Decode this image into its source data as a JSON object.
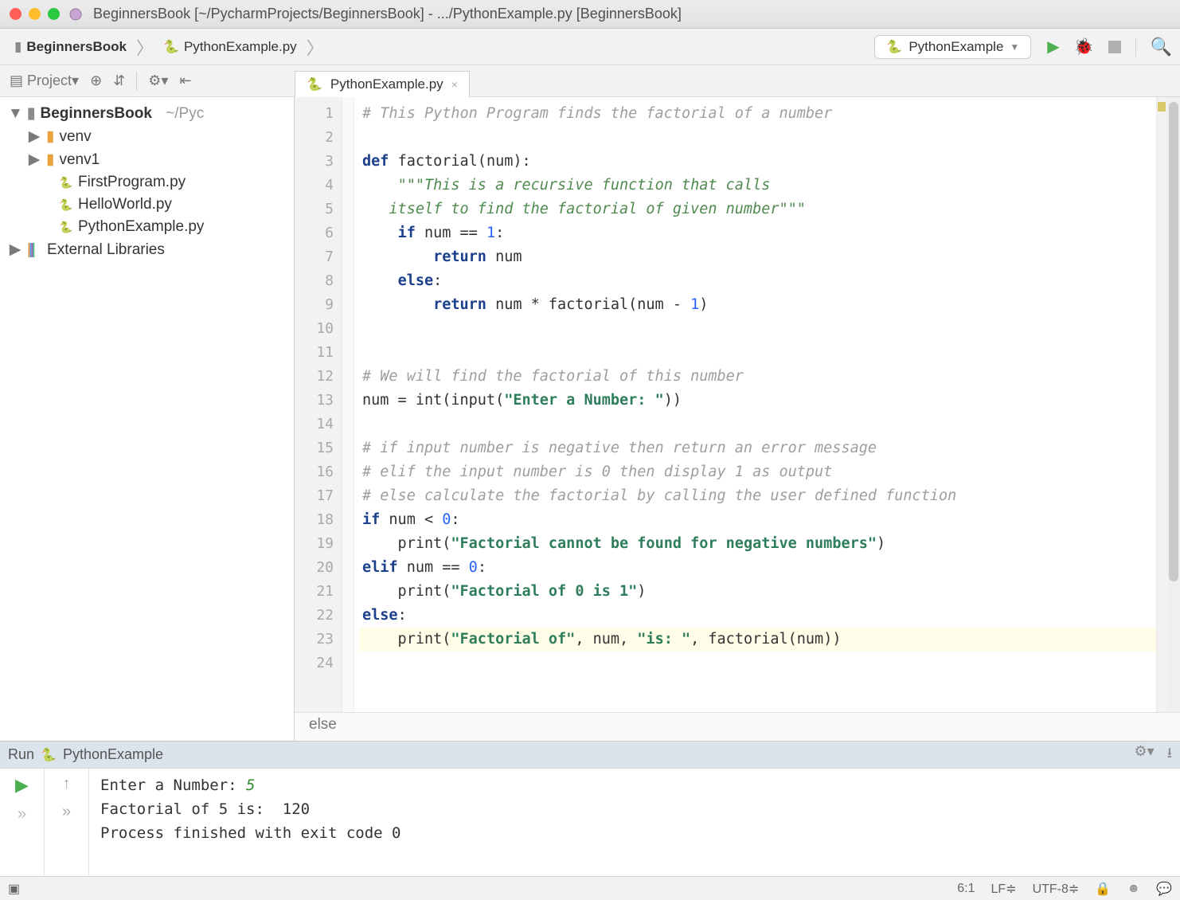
{
  "titlebar": {
    "title": "BeginnersBook [~/PycharmProjects/BeginnersBook] - .../PythonExample.py [BeginnersBook]"
  },
  "breadcrumbs": {
    "items": [
      "BeginnersBook",
      "PythonExample.py"
    ]
  },
  "run_config": {
    "label": "PythonExample"
  },
  "project_tool": {
    "label": "Project"
  },
  "tab": {
    "label": "PythonExample.py"
  },
  "tree": {
    "root": {
      "name": "BeginnersBook",
      "path": "~/PycharmProjects/BeginnersBook"
    },
    "folders": [
      "venv",
      "venv1"
    ],
    "files": [
      "FirstProgram.py",
      "HelloWorld.py",
      "PythonExample.py"
    ],
    "ext": "External Libraries"
  },
  "code": {
    "lines": [
      {
        "n": 1,
        "seg": [
          {
            "t": "# This Python Program finds the factorial of a number",
            "c": "c-comment"
          }
        ]
      },
      {
        "n": 2,
        "seg": []
      },
      {
        "n": 3,
        "seg": [
          {
            "t": "def ",
            "c": "c-kw"
          },
          {
            "t": "factorial(num):",
            "c": "c-fn"
          }
        ]
      },
      {
        "n": 4,
        "seg": [
          {
            "t": "    ",
            "c": ""
          },
          {
            "t": "\"\"\"This is a recursive function that calls",
            "c": "c-doc"
          }
        ]
      },
      {
        "n": 5,
        "seg": [
          {
            "t": "   itself to find the factorial of given number\"\"\"",
            "c": "c-doc"
          }
        ]
      },
      {
        "n": 6,
        "seg": [
          {
            "t": "    ",
            "c": ""
          },
          {
            "t": "if ",
            "c": "c-kw"
          },
          {
            "t": "num == ",
            "c": ""
          },
          {
            "t": "1",
            "c": "c-num"
          },
          {
            "t": ":",
            "c": ""
          }
        ]
      },
      {
        "n": 7,
        "seg": [
          {
            "t": "        ",
            "c": ""
          },
          {
            "t": "return ",
            "c": "c-kw"
          },
          {
            "t": "num",
            "c": ""
          }
        ]
      },
      {
        "n": 8,
        "seg": [
          {
            "t": "    ",
            "c": ""
          },
          {
            "t": "else",
            "c": "c-kw"
          },
          {
            "t": ":",
            "c": ""
          }
        ]
      },
      {
        "n": 9,
        "seg": [
          {
            "t": "        ",
            "c": ""
          },
          {
            "t": "return ",
            "c": "c-kw"
          },
          {
            "t": "num * factorial(num - ",
            "c": ""
          },
          {
            "t": "1",
            "c": "c-num"
          },
          {
            "t": ")",
            "c": ""
          }
        ]
      },
      {
        "n": 10,
        "seg": []
      },
      {
        "n": 11,
        "seg": []
      },
      {
        "n": 12,
        "seg": [
          {
            "t": "# We will find the factorial of this number",
            "c": "c-comment"
          }
        ]
      },
      {
        "n": 13,
        "seg": [
          {
            "t": "num = int(input(",
            "c": ""
          },
          {
            "t": "\"Enter a Number: \"",
            "c": "c-str"
          },
          {
            "t": "))",
            "c": ""
          }
        ]
      },
      {
        "n": 14,
        "seg": []
      },
      {
        "n": 15,
        "seg": [
          {
            "t": "# if input number is negative then return an error message",
            "c": "c-comment"
          }
        ]
      },
      {
        "n": 16,
        "seg": [
          {
            "t": "# elif the input number is 0 then display 1 as output",
            "c": "c-comment"
          }
        ]
      },
      {
        "n": 17,
        "seg": [
          {
            "t": "# else calculate the factorial by calling the user defined function",
            "c": "c-comment"
          }
        ]
      },
      {
        "n": 18,
        "seg": [
          {
            "t": "if ",
            "c": "c-kw"
          },
          {
            "t": "num < ",
            "c": ""
          },
          {
            "t": "0",
            "c": "c-num"
          },
          {
            "t": ":",
            "c": ""
          }
        ]
      },
      {
        "n": 19,
        "seg": [
          {
            "t": "    print(",
            "c": ""
          },
          {
            "t": "\"Factorial cannot be found for negative numbers\"",
            "c": "c-str"
          },
          {
            "t": ")",
            "c": ""
          }
        ]
      },
      {
        "n": 20,
        "seg": [
          {
            "t": "elif ",
            "c": "c-kw"
          },
          {
            "t": "num == ",
            "c": ""
          },
          {
            "t": "0",
            "c": "c-num"
          },
          {
            "t": ":",
            "c": ""
          }
        ]
      },
      {
        "n": 21,
        "seg": [
          {
            "t": "    print(",
            "c": ""
          },
          {
            "t": "\"Factorial of 0 is 1\"",
            "c": "c-str"
          },
          {
            "t": ")",
            "c": ""
          }
        ]
      },
      {
        "n": 22,
        "seg": [
          {
            "t": "else",
            "c": "c-kw"
          },
          {
            "t": ":",
            "c": ""
          }
        ]
      },
      {
        "n": 23,
        "hl": true,
        "seg": [
          {
            "t": "    print(",
            "c": ""
          },
          {
            "t": "\"Factorial of\"",
            "c": "c-str"
          },
          {
            "t": ", num, ",
            "c": ""
          },
          {
            "t": "\"is: \"",
            "c": "c-str"
          },
          {
            "t": ", factorial(num))",
            "c": ""
          }
        ]
      },
      {
        "n": 24,
        "seg": []
      }
    ],
    "crumb": "else"
  },
  "run": {
    "title": "Run",
    "config": "PythonExample",
    "out": [
      {
        "seg": [
          {
            "t": "Enter a Number: "
          },
          {
            "t": "5",
            "c": "r-in"
          }
        ]
      },
      {
        "seg": [
          {
            "t": "Factorial of 5 is:  120"
          }
        ]
      },
      {
        "seg": [
          {
            "t": ""
          }
        ]
      },
      {
        "seg": [
          {
            "t": "Process finished with exit code 0"
          }
        ]
      }
    ]
  },
  "status": {
    "pos": "6:1",
    "lf": "LF",
    "enc": "UTF-8"
  }
}
